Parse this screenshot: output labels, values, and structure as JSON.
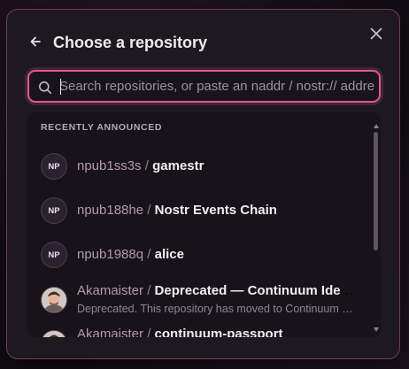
{
  "modal": {
    "title": "Choose a repository",
    "back_icon": "arrow-left-icon",
    "close_icon": "close-icon"
  },
  "search": {
    "placeholder": "Search repositories, or paste an naddr / nostr:// address",
    "value": "",
    "icon": "search-icon",
    "accent_color": "#e0569a"
  },
  "results": {
    "section_label": "RECENTLY ANNOUNCED",
    "items": [
      {
        "avatar_initials": "NP",
        "owner": "npub1ss3s",
        "separator": "/",
        "repo": "gamestr",
        "description": ""
      },
      {
        "avatar_initials": "NP",
        "owner": "npub188he",
        "separator": "/",
        "repo": "Nostr Events Chain",
        "description": ""
      },
      {
        "avatar_initials": "NP",
        "owner": "npub1988q",
        "separator": "/",
        "repo": "alice",
        "description": ""
      },
      {
        "avatar_initials": "",
        "owner": "Akamaister",
        "separator": "/",
        "repo": "Deprecated — Continuum Identity",
        "description": "Deprecated. This repository has moved to Continuum Passport."
      },
      {
        "avatar_initials": "",
        "owner": "Akamaister",
        "separator": "/",
        "repo": "continuum-passport",
        "description": ""
      }
    ]
  }
}
